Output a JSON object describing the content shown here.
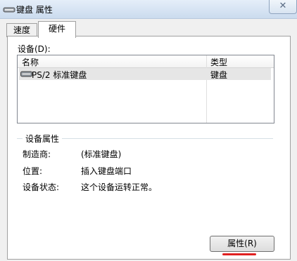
{
  "window": {
    "title": "键盘 属性",
    "close_symbol": "✕"
  },
  "tabs": [
    {
      "label": "速度",
      "active": false
    },
    {
      "label": "硬件",
      "active": true
    }
  ],
  "devices": {
    "label": "设备(D):",
    "columns": [
      "名称",
      "类型"
    ],
    "rows": [
      {
        "name": "PS/2 标准键盘",
        "type": "键盘",
        "icon": "keyboard-icon",
        "selected": true
      }
    ]
  },
  "properties": {
    "group_title": "设备属性",
    "items": [
      {
        "label": "制造商:",
        "value": "(标准键盘)"
      },
      {
        "label": "位置:",
        "value": "插入键盘端口"
      },
      {
        "label": "设备状态:",
        "value": "这个设备运转正常。"
      }
    ],
    "button_label": "属性(R)"
  },
  "colors": {
    "highlight_underline": "#e02020",
    "selected_row": "#e6e6e6",
    "title_bar": "#cbdbee"
  }
}
